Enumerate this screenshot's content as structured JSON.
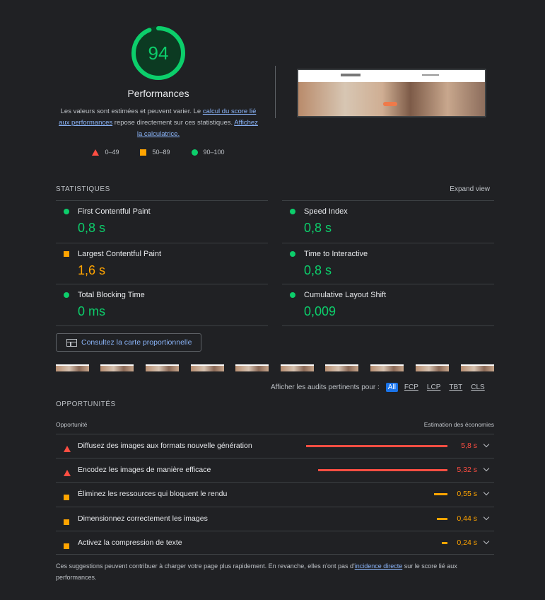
{
  "colors": {
    "pass": "#0cce6b",
    "average": "#ffa400",
    "fail": "#ff4e42",
    "link": "#8ab4f8",
    "background": "#202124"
  },
  "gauge": {
    "score": "94",
    "score_fraction": 0.94,
    "title": "Performances",
    "desc_1": "Les valeurs sont estimées et peuvent varier. Le ",
    "link_1": "calcul du score lié aux performances",
    "desc_2": " repose directement sur ces statistiques. ",
    "link_2": "Affichez la calculatrice.",
    "legend": [
      "0–49",
      "50–89",
      "90–100"
    ]
  },
  "metrics_section": {
    "label": "STATISTIQUES",
    "expand": "Expand view",
    "items": [
      {
        "name": "First Contentful Paint",
        "value": "0,8 s",
        "rating": "pass"
      },
      {
        "name": "Speed Index",
        "value": "0,8 s",
        "rating": "pass"
      },
      {
        "name": "Largest Contentful Paint",
        "value": "1,6 s",
        "rating": "average"
      },
      {
        "name": "Time to Interactive",
        "value": "0,8 s",
        "rating": "pass"
      },
      {
        "name": "Total Blocking Time",
        "value": "0 ms",
        "rating": "pass"
      },
      {
        "name": "Cumulative Layout Shift",
        "value": "0,009",
        "rating": "pass"
      }
    ]
  },
  "treemap_button": "Consultez la carte proportionnelle",
  "filter": {
    "label": "Afficher les audits pertinents pour :",
    "chips": [
      "All",
      "FCP",
      "LCP",
      "TBT",
      "CLS"
    ],
    "active": "All"
  },
  "opportunities": {
    "label": "OPPORTUNITÉS",
    "col_left": "Opportunité",
    "col_right": "Estimation des économies",
    "items": [
      {
        "title": "Diffusez des images aux formats nouvelle génération",
        "saving": "5,8 s",
        "seconds": 5.8,
        "rating": "fail"
      },
      {
        "title": "Encodez les images de manière efficace",
        "saving": "5,32 s",
        "seconds": 5.32,
        "rating": "fail"
      },
      {
        "title": "Éliminez les ressources qui bloquent le rendu",
        "saving": "0,55 s",
        "seconds": 0.55,
        "rating": "average"
      },
      {
        "title": "Dimensionnez correctement les images",
        "saving": "0,44 s",
        "seconds": 0.44,
        "rating": "average"
      },
      {
        "title": "Activez la compression de texte",
        "saving": "0,24 s",
        "seconds": 0.24,
        "rating": "average"
      }
    ]
  },
  "footnote": {
    "text_1": "Ces suggestions peuvent contribuer à charger votre page plus rapidement. En revanche, elles n'ont pas d'",
    "link": "incidence directe",
    "text_2": " sur le score lié aux performances."
  }
}
